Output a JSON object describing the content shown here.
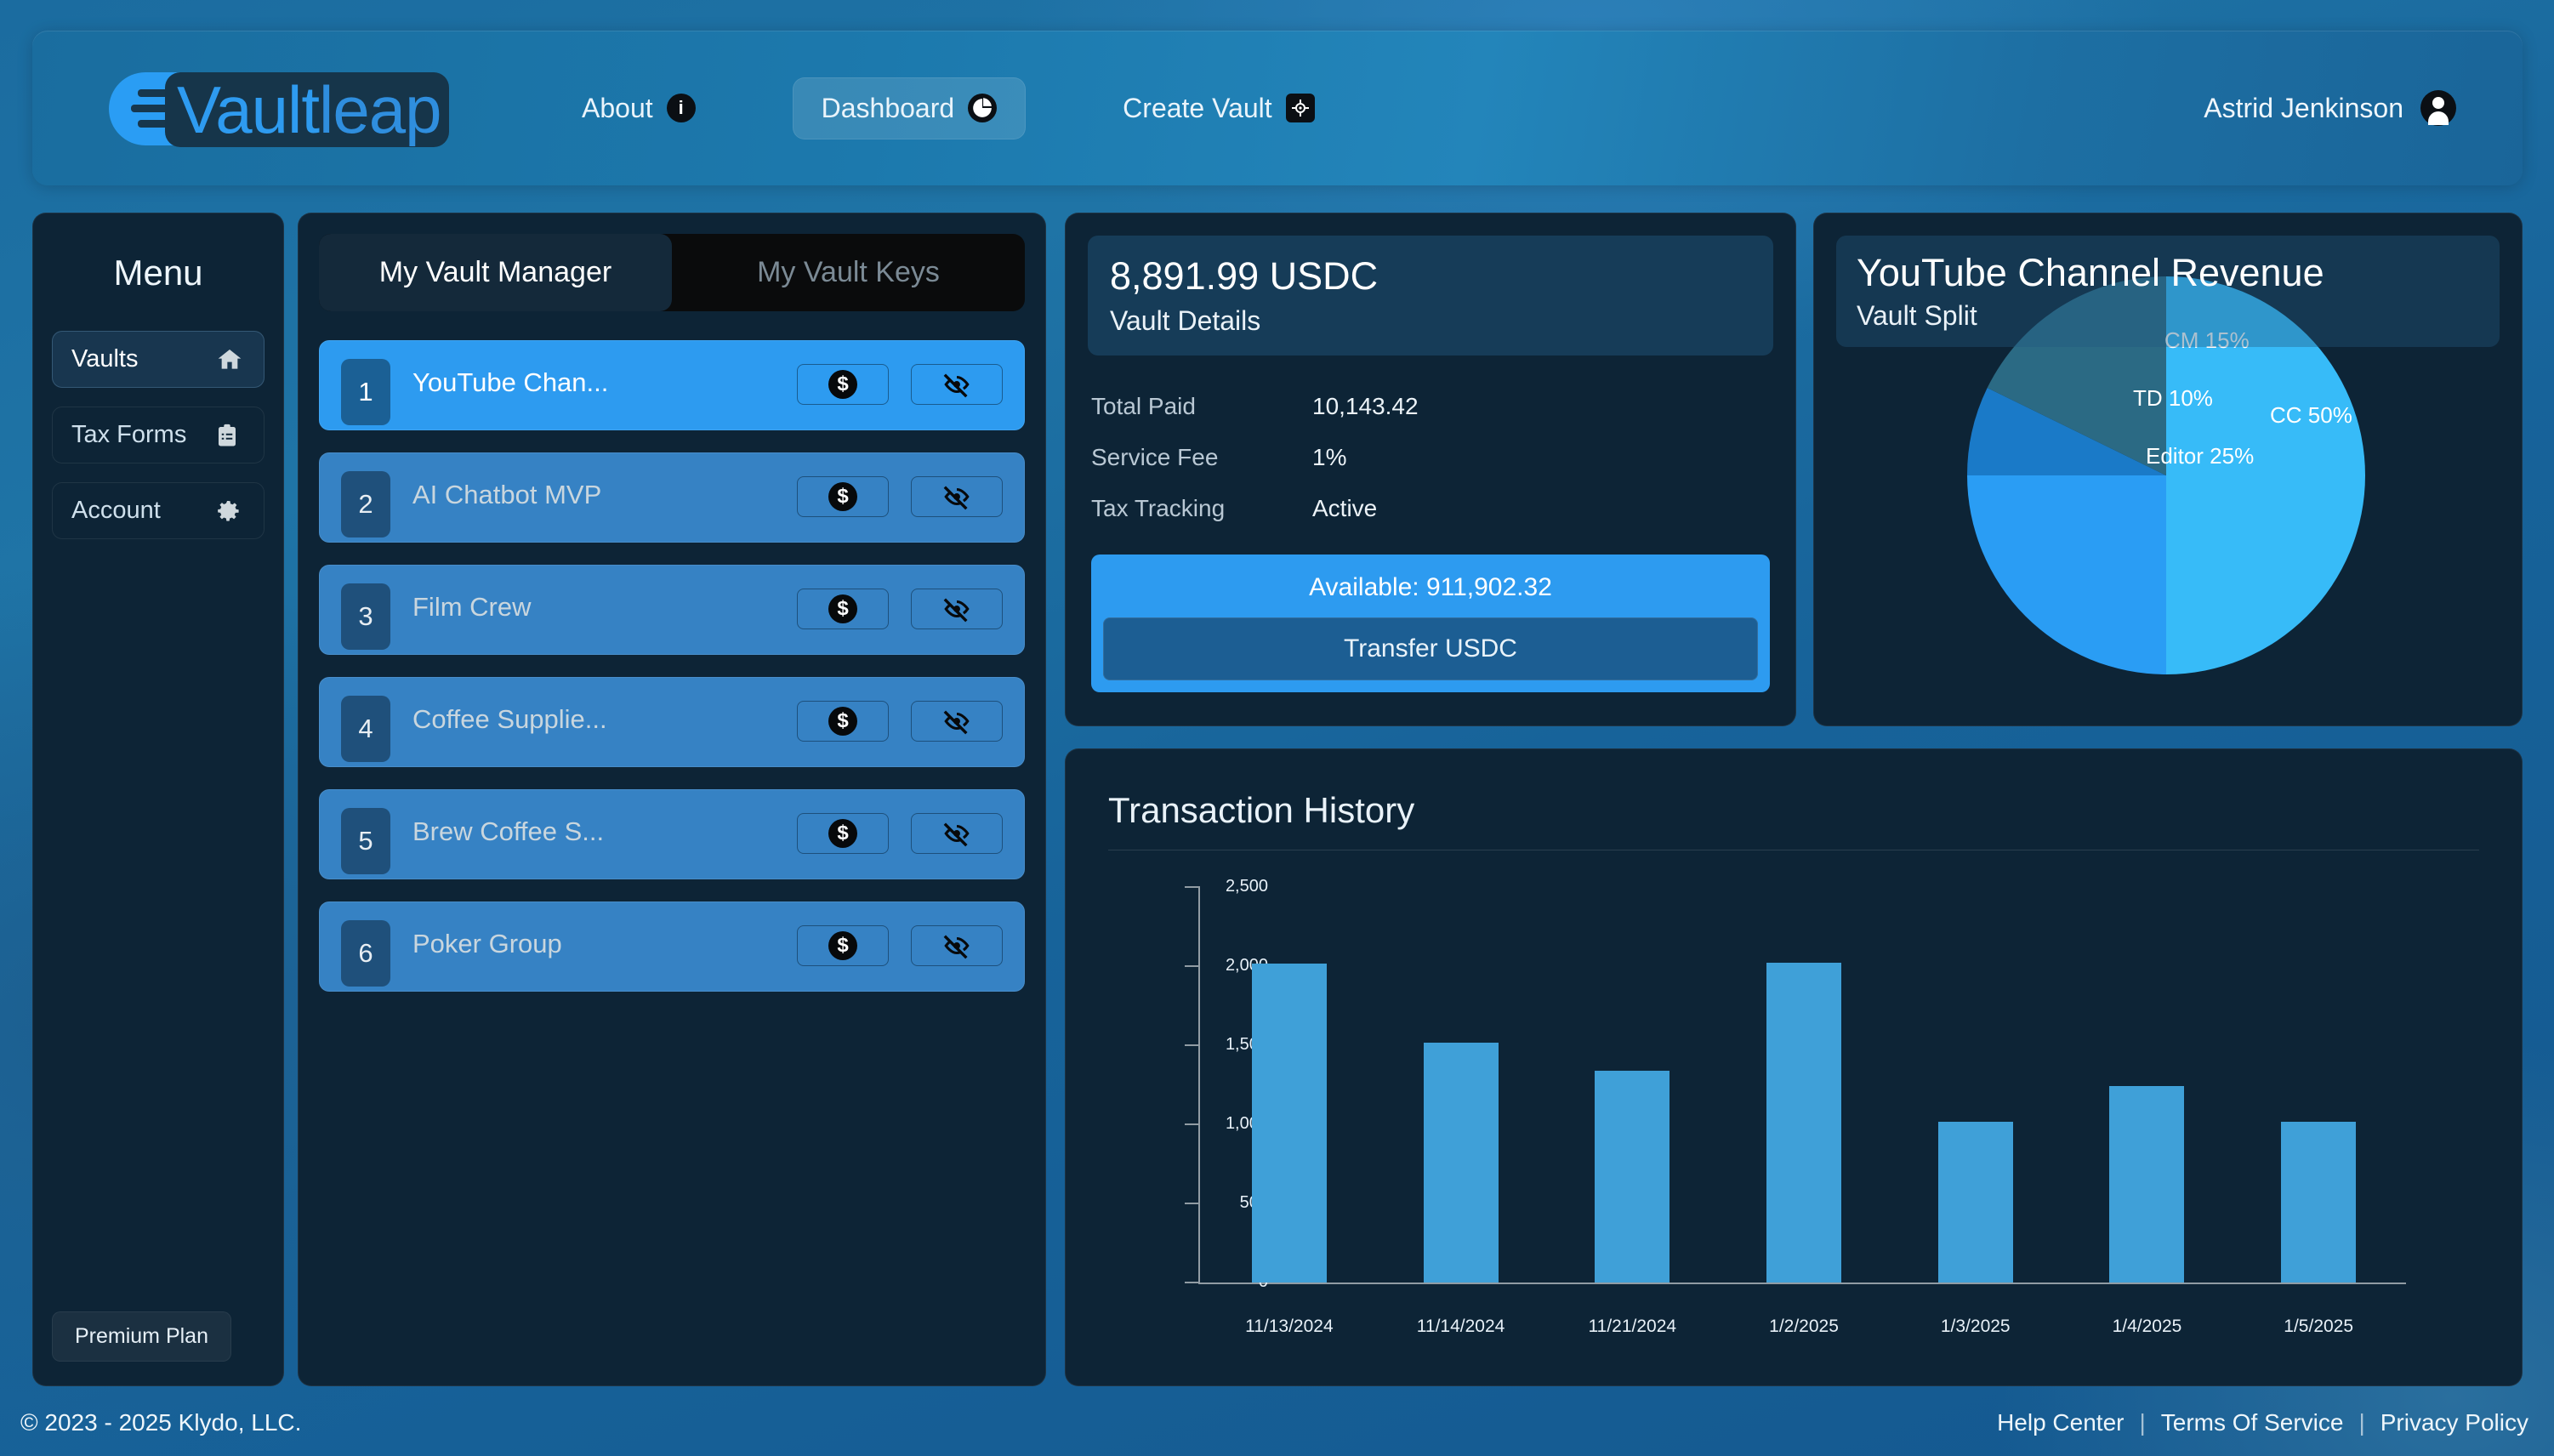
{
  "brand": {
    "part1": "Vault",
    "part2": "leap"
  },
  "nav": {
    "items": [
      {
        "label": "About",
        "icon": "info-icon",
        "glyph": "i",
        "active": false
      },
      {
        "label": "Dashboard",
        "icon": "pie-chart-icon",
        "glyph": "◕",
        "active": true
      },
      {
        "label": "Create Vault",
        "icon": "vault-icon",
        "glyph": "◈",
        "active": false
      }
    ],
    "user": {
      "name": "Astrid Jenkinson",
      "icon": "user-avatar-icon"
    }
  },
  "sidebar": {
    "title": "Menu",
    "items": [
      {
        "label": "Vaults",
        "icon": "home-icon",
        "active": true
      },
      {
        "label": "Tax Forms",
        "icon": "clipboard-icon",
        "active": false
      },
      {
        "label": "Account",
        "icon": "gear-icon",
        "active": false
      }
    ],
    "plan_badge": "Premium Plan"
  },
  "vault_manager": {
    "tabs": [
      {
        "label": "My Vault Manager",
        "active": true
      },
      {
        "label": "My Vault Keys",
        "active": false
      }
    ],
    "rows": [
      {
        "num": "1",
        "name": "YouTube Chan...",
        "selected": true
      },
      {
        "num": "2",
        "name": "AI Chatbot MVP",
        "selected": false
      },
      {
        "num": "3",
        "name": "Film Crew",
        "selected": false
      },
      {
        "num": "4",
        "name": "Coffee Supplie...",
        "selected": false
      },
      {
        "num": "5",
        "name": "Brew Coffee S...",
        "selected": false
      },
      {
        "num": "6",
        "name": "Poker Group",
        "selected": false
      }
    ],
    "row_actions": {
      "pay_icon": "dollar-coin-icon",
      "hide_icon": "eye-off-icon"
    }
  },
  "vault_details": {
    "amount": "8,891.99 USDC",
    "subtitle": "Vault Details",
    "rows": [
      {
        "key": "Total Paid",
        "value": "10,143.42"
      },
      {
        "key": "Service Fee",
        "value": "1%"
      },
      {
        "key": "Tax Tracking",
        "value": "Active"
      }
    ],
    "available_label": "Available: 911,902.32",
    "transfer_button": "Transfer USDC"
  },
  "pie_card": {
    "title": "YouTube Channel Revenue",
    "subtitle": "Vault Split"
  },
  "transactions": {
    "title": "Transaction History"
  },
  "footer": {
    "copyright": "© 2023 - 2025 Klydo, LLC.",
    "links": [
      "Help Center",
      "Terms Of Service",
      "Privacy Policy"
    ],
    "separator": "|"
  },
  "colors": {
    "accent_blue": "#2d9bf0",
    "panel_bg": "#0d2436",
    "bar_blue": "#3fa0d8",
    "row_blue": "#3682c4"
  },
  "chart_data": [
    {
      "type": "pie",
      "title": "YouTube Channel Revenue",
      "subtitle": "Vault Split",
      "labels": [
        "CC",
        "Editor",
        "TD",
        "CM"
      ],
      "values": [
        50,
        25,
        10,
        15
      ],
      "value_labels": [
        "CC 50%",
        "Editor 25%",
        "TD 10%",
        "CM 15%"
      ],
      "colors": [
        "#37bbf8",
        "#2a9df4",
        "#1a7ac8",
        "#2b6a84"
      ],
      "start_angle_deg": 0,
      "direction": "clockwise",
      "legend": "none"
    },
    {
      "type": "bar",
      "title": "Transaction History",
      "xlabel": "",
      "ylabel": "",
      "categories": [
        "11/13/2024",
        "11/14/2024",
        "11/21/2024",
        "1/2/2025",
        "1/3/2025",
        "1/4/2025",
        "1/5/2025"
      ],
      "values": [
        2013,
        1515,
        1338,
        2018,
        1012,
        1237,
        1012
      ],
      "ylim": [
        0,
        2500
      ],
      "yticks": [
        0,
        500,
        1000,
        1500,
        2000,
        2500
      ],
      "ytick_labels": [
        "0",
        "500",
        "1,000",
        "1,500",
        "2,000",
        "2,500"
      ],
      "grid": false,
      "bar_color": "#3fa0d8"
    }
  ]
}
